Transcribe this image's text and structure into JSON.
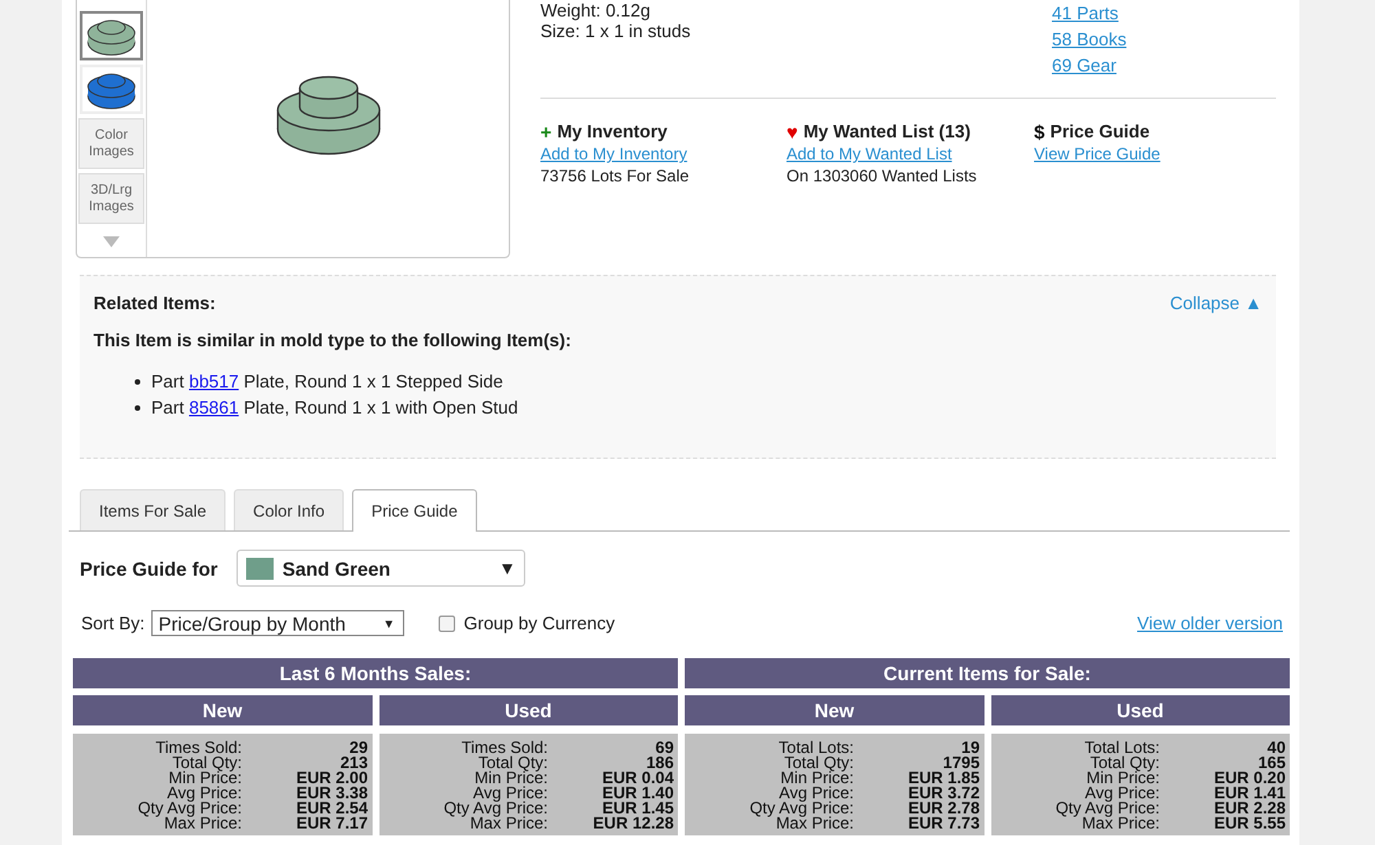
{
  "product": {
    "thumbnails": [
      {
        "selected": true,
        "color": "#8fb39a"
      },
      {
        "selected": false,
        "color": "#1f6fd0"
      }
    ],
    "image_buttons": [
      "Color Images",
      "3D/Lrg Images"
    ],
    "details": [
      "Weight: 0.12g",
      "Size: 1 x 1 in studs"
    ],
    "links": [
      "41 Parts",
      "58 Books",
      "69 Gear"
    ],
    "actions": [
      {
        "kind": "plus",
        "symbol": "+",
        "title": "My Inventory",
        "link": "Add to My Inventory",
        "note": "73756 Lots For Sale"
      },
      {
        "kind": "heart",
        "symbol": "♥",
        "title": "My Wanted List (13)",
        "link": "Add to My Wanted List",
        "note": "On 1303060 Wanted Lists"
      },
      {
        "kind": "dollar",
        "symbol": "$",
        "title": "Price Guide",
        "link": "View Price Guide"
      }
    ]
  },
  "related": {
    "title": "Related Items:",
    "collapse": "Collapse ▲",
    "heading": "This Item is similar in mold type to the following Item(s):",
    "items": [
      {
        "prefix": "Part",
        "id": "bb517",
        "name": "Plate, Round 1 x 1 Stepped Side"
      },
      {
        "prefix": "Part",
        "id": "85861",
        "name": "Plate, Round 1 x 1 with Open Stud"
      }
    ]
  },
  "tabs": [
    {
      "label": "Items For Sale",
      "selected": false
    },
    {
      "label": "Color Info",
      "selected": false
    },
    {
      "label": "Price Guide",
      "selected": true
    }
  ],
  "price_guide": {
    "label": "Price Guide for",
    "color_select": {
      "value": "Sand Green",
      "caret": "▼"
    },
    "sort_label": "Sort By:",
    "sort_select": {
      "value": "Price/Group by Month",
      "caret": "▼"
    },
    "group_by_currency": {
      "label": "Group by Currency",
      "checked": false
    },
    "older_link": "View older version"
  },
  "tables": [
    {
      "title": "Last 6 Months Sales:",
      "columns": [
        {
          "title": "New",
          "rows": [
            {
              "label": "Times Sold:",
              "value": "29"
            },
            {
              "label": "Total Qty:",
              "value": "213"
            },
            {
              "label": "Min Price:",
              "value": "EUR 2.00"
            },
            {
              "label": "Avg Price:",
              "value": "EUR 3.38"
            },
            {
              "label": "Qty Avg Price:",
              "value": "EUR 2.54"
            },
            {
              "label": "Max Price:",
              "value": "EUR 7.17"
            }
          ]
        },
        {
          "title": "Used",
          "rows": [
            {
              "label": "Times Sold:",
              "value": "69"
            },
            {
              "label": "Total Qty:",
              "value": "186"
            },
            {
              "label": "Min Price:",
              "value": "EUR 0.04"
            },
            {
              "label": "Avg Price:",
              "value": "EUR 1.40"
            },
            {
              "label": "Qty Avg Price:",
              "value": "EUR 1.45"
            },
            {
              "label": "Max Price:",
              "value": "EUR 12.28"
            }
          ]
        }
      ]
    },
    {
      "title": "Current Items for Sale:",
      "columns": [
        {
          "title": "New",
          "rows": [
            {
              "label": "Total Lots:",
              "value": "19"
            },
            {
              "label": "Total Qty:",
              "value": "1795"
            },
            {
              "label": "Min Price:",
              "value": "EUR 1.85"
            },
            {
              "label": "Avg Price:",
              "value": "EUR 3.72"
            },
            {
              "label": "Qty Avg Price:",
              "value": "EUR 2.78"
            },
            {
              "label": "Max Price:",
              "value": "EUR 7.73"
            }
          ]
        },
        {
          "title": "Used",
          "rows": [
            {
              "label": "Total Lots:",
              "value": "40"
            },
            {
              "label": "Total Qty:",
              "value": "165"
            },
            {
              "label": "Min Price:",
              "value": "EUR 0.20"
            },
            {
              "label": "Avg Price:",
              "value": "EUR 1.41"
            },
            {
              "label": "Qty Avg Price:",
              "value": "EUR 2.28"
            },
            {
              "label": "Max Price:",
              "value": "EUR 5.55"
            }
          ]
        }
      ]
    }
  ]
}
